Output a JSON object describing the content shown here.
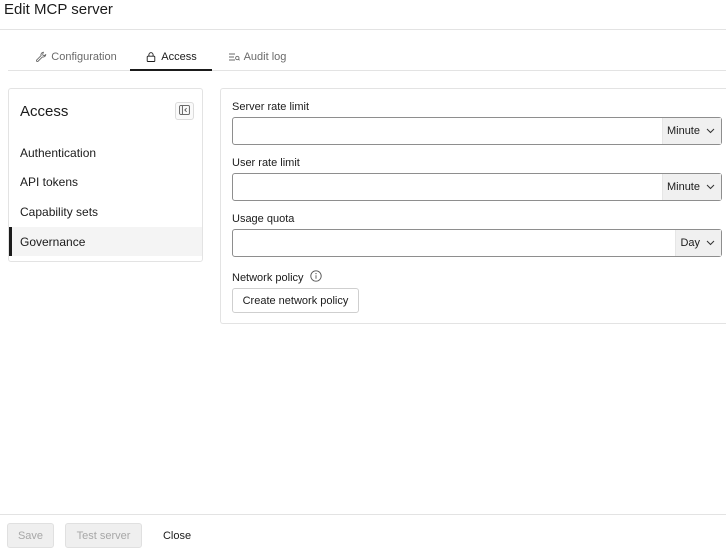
{
  "dialog": {
    "title": "Edit MCP server"
  },
  "tabs": [
    {
      "label": "Configuration",
      "icon": "wrench-icon",
      "active": false
    },
    {
      "label": "Access",
      "icon": "lock-icon",
      "active": true
    },
    {
      "label": "Audit log",
      "icon": "audit-log-icon",
      "active": false
    }
  ],
  "sidebar": {
    "title": "Access",
    "collapse_icon": "collapse-panel-icon",
    "items": [
      {
        "label": "Authentication",
        "selected": false
      },
      {
        "label": "API tokens",
        "selected": false
      },
      {
        "label": "Capability sets",
        "selected": false
      },
      {
        "label": "Governance",
        "selected": true
      }
    ]
  },
  "governance": {
    "server_rate_limit": {
      "label": "Server rate limit",
      "value": "",
      "unit": "Minute"
    },
    "user_rate_limit": {
      "label": "User rate limit",
      "value": "",
      "unit": "Minute"
    },
    "usage_quota": {
      "label": "Usage quota",
      "value": "",
      "unit": "Day"
    },
    "network_policy": {
      "label": "Network policy",
      "info_icon": "info-icon",
      "button_label": "Create network policy"
    }
  },
  "footer": {
    "save_label": "Save",
    "test_label": "Test server",
    "close_label": "Close",
    "save_disabled": true,
    "test_disabled": true
  },
  "colors": {
    "text": "#1b1b1b",
    "muted": "#6a6a6a",
    "border": "#e3e3e3",
    "disabled_bg": "#efefef"
  }
}
